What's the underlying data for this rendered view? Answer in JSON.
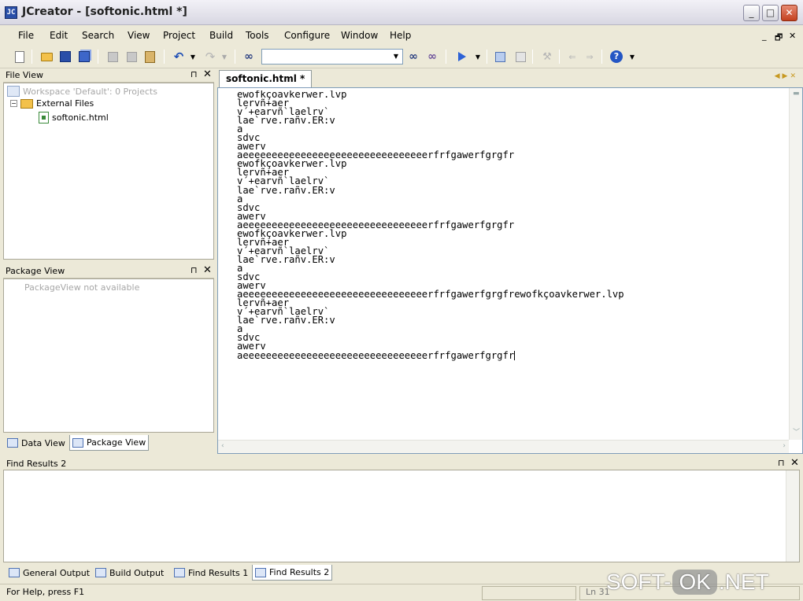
{
  "window": {
    "title": "JCreator - [softonic.html *]",
    "app_icon": "JC",
    "controls": {
      "minimize": "_",
      "maximize": "□",
      "close": "✕"
    }
  },
  "menu": {
    "items": [
      "File",
      "Edit",
      "Search",
      "View",
      "Project",
      "Build",
      "Tools",
      "Configure",
      "Window",
      "Help"
    ],
    "mdi_controls": [
      "_",
      "🗗",
      "✕"
    ]
  },
  "toolbar": {
    "icons": [
      "new-file-icon",
      "open-folder-icon",
      "save-icon",
      "save-all-icon",
      "cut-icon",
      "copy-icon",
      "paste-icon",
      "undo-icon",
      "redo-icon",
      "find-icon",
      "find-next-icon",
      "replace-icon",
      "run-icon",
      "compile-icon",
      "build-icon",
      "debug-icon",
      "back-icon",
      "forward-icon",
      "help-icon"
    ],
    "search_value": ""
  },
  "file_view": {
    "title": "File View",
    "pin": "⊓",
    "close": "✕",
    "workspace": "Workspace 'Default': 0 Projects",
    "folder": "External Files",
    "file": "softonic.html"
  },
  "package_view": {
    "title": "Package View",
    "pin": "⊓",
    "close": "✕",
    "message": "PackageView not available"
  },
  "left_tabs": [
    "Data View",
    "Package View"
  ],
  "editor": {
    "tab": "softonic.html *",
    "lines": [
      "ewofkçoavkerwer.lvp",
      "lervñ+aer",
      "v´+earvñ`laelrv`",
      "lae`rve.rañv.ER:v",
      "a",
      "sdvc",
      "awerv",
      "aeeeeeeeeeeeeeeeeeeeeeeeeeeeeeeeerfrfgawerfgrgfr",
      "ewofkçoavkerwer.lvp",
      "lervñ+aer",
      "v´+earvñ`laelrv`",
      "lae`rve.rañv.ER:v",
      "a",
      "sdvc",
      "awerv",
      "aeeeeeeeeeeeeeeeeeeeeeeeeeeeeeeeerfrfgawerfgrgfr",
      "ewofkçoavkerwer.lvp",
      "lervñ+aer",
      "v´+earvñ`laelrv`",
      "lae`rve.rañv.ER:v",
      "a",
      "sdvc",
      "awerv",
      "aeeeeeeeeeeeeeeeeeeeeeeeeeeeeeeeerfrfgawerfgrgfrewofkçoavkerwer.lvp",
      "lervñ+aer",
      "v´+earvñ`laelrv`",
      "lae`rve.rañv.ER:v",
      "a",
      "sdvc",
      "awerv",
      "aeeeeeeeeeeeeeeeeeeeeeeeeeeeeeeeerfrfgawerfgrgfr"
    ]
  },
  "find_results": {
    "title": "Find Results 2",
    "pin": "⊓",
    "close": "✕"
  },
  "bottom_tabs": [
    "General Output",
    "Build Output",
    "Find Results 1",
    "Find Results 2"
  ],
  "status": {
    "help": "For Help, press F1",
    "position": "Ln 31"
  },
  "watermark": {
    "left": "SOFT-",
    "mid": "OK",
    "right": ".NET"
  }
}
